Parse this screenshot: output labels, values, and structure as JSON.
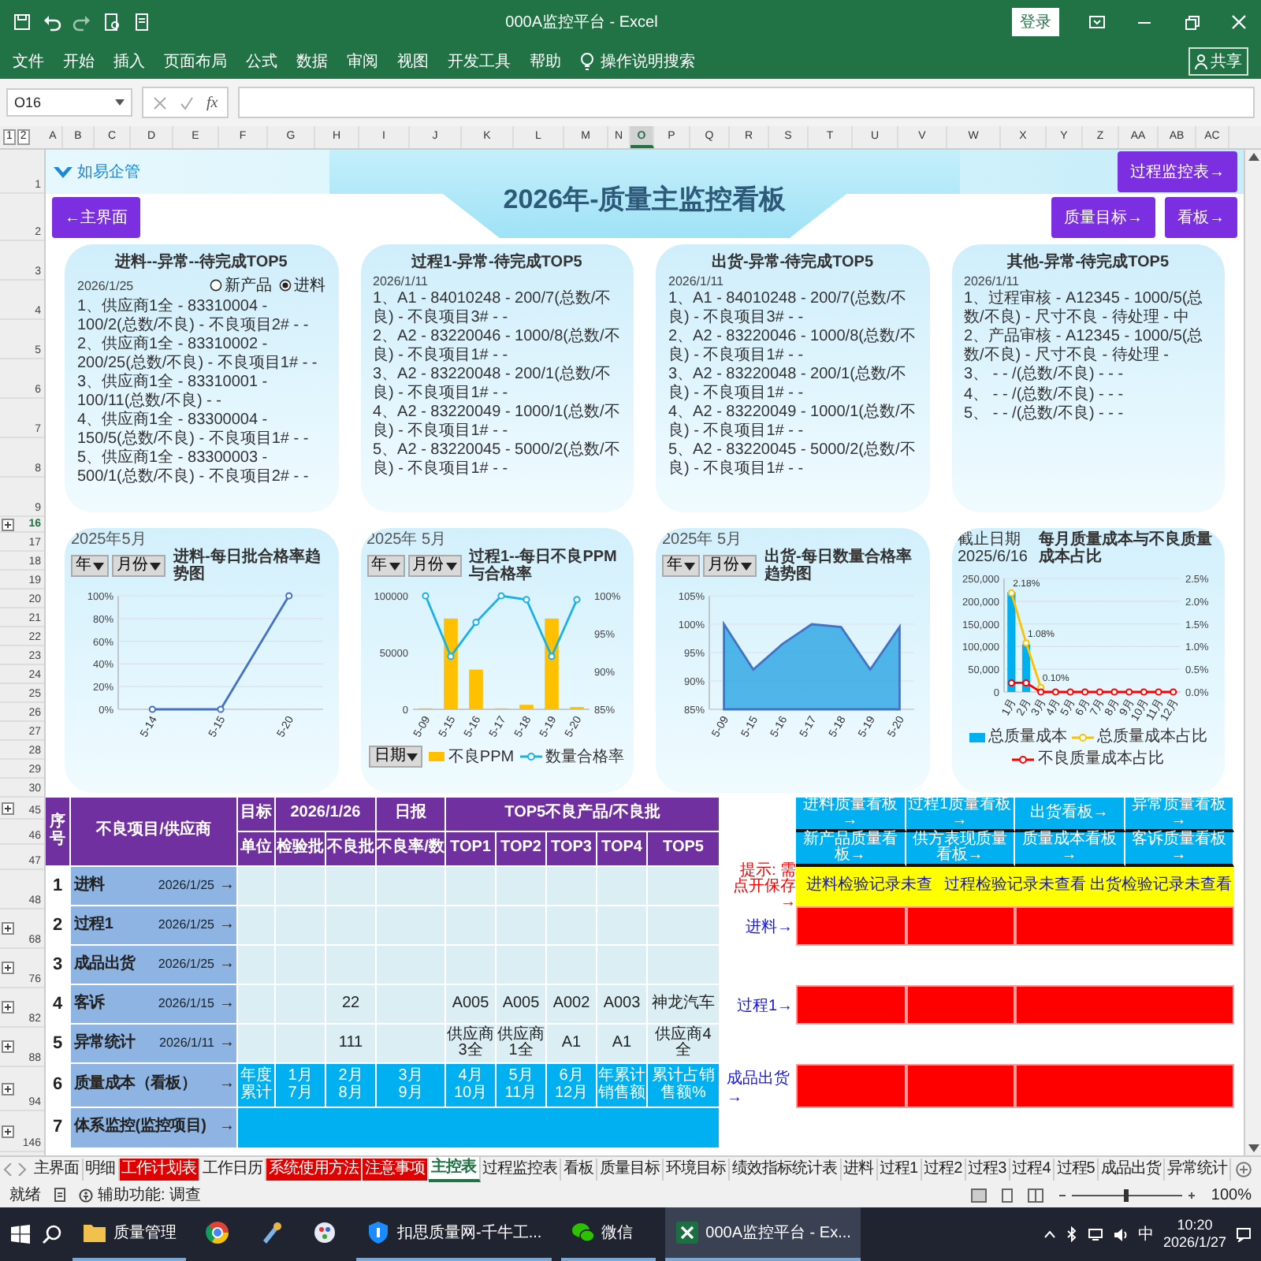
{
  "window": {
    "title": "000A监控平台 - Excel",
    "login": "登录",
    "share": "共享"
  },
  "menu": [
    "文件",
    "开始",
    "插入",
    "页面布局",
    "公式",
    "数据",
    "审阅",
    "视图",
    "开发工具",
    "帮助"
  ],
  "search_hint": "操作说明搜索",
  "formula_bar": {
    "name_box": "O16",
    "function_label": "fx"
  },
  "outline_levels": [
    "1",
    "2"
  ],
  "columns": [
    {
      "label": "A",
      "selected": false
    },
    {
      "label": "B",
      "selected": false
    },
    {
      "label": "C",
      "selected": false
    },
    {
      "label": "D",
      "selected": false
    },
    {
      "label": "E",
      "selected": false
    },
    {
      "label": "F",
      "selected": false
    },
    {
      "label": "G",
      "selected": false
    },
    {
      "label": "H",
      "selected": false
    },
    {
      "label": "I",
      "selected": false
    },
    {
      "label": "J",
      "selected": false
    },
    {
      "label": "K",
      "selected": false
    },
    {
      "label": "L",
      "selected": false
    },
    {
      "label": "M",
      "selected": false
    },
    {
      "label": "N",
      "selected": false
    },
    {
      "label": "O",
      "selected": true
    },
    {
      "label": "P",
      "selected": false
    },
    {
      "label": "Q",
      "selected": false
    },
    {
      "label": "R",
      "selected": false
    },
    {
      "label": "S",
      "selected": false
    },
    {
      "label": "T",
      "selected": false
    },
    {
      "label": "U",
      "selected": false
    },
    {
      "label": "V",
      "selected": false
    },
    {
      "label": "W",
      "selected": false
    },
    {
      "label": "X",
      "selected": false
    },
    {
      "label": "Y",
      "selected": false
    },
    {
      "label": "Z",
      "selected": false
    },
    {
      "label": "AA",
      "selected": false
    },
    {
      "label": "AB",
      "selected": false
    },
    {
      "label": "AC",
      "selected": false
    }
  ],
  "rows": [
    {
      "label": "1",
      "selected": false,
      "collapsed": false
    },
    {
      "label": "2",
      "selected": false,
      "collapsed": false
    },
    {
      "label": "3",
      "selected": false,
      "collapsed": false
    },
    {
      "label": "4",
      "selected": false,
      "collapsed": false
    },
    {
      "label": "5",
      "selected": false,
      "collapsed": false
    },
    {
      "label": "6",
      "selected": false,
      "collapsed": false
    },
    {
      "label": "7",
      "selected": false,
      "collapsed": false
    },
    {
      "label": "8",
      "selected": false,
      "collapsed": false
    },
    {
      "label": "9",
      "selected": false,
      "collapsed": false
    },
    {
      "label": "16",
      "selected": true,
      "collapsed": true
    },
    {
      "label": "17",
      "selected": false,
      "collapsed": false
    },
    {
      "label": "18",
      "selected": false,
      "collapsed": false
    },
    {
      "label": "19",
      "selected": false,
      "collapsed": false
    },
    {
      "label": "20",
      "selected": false,
      "collapsed": false
    },
    {
      "label": "21",
      "selected": false,
      "collapsed": false
    },
    {
      "label": "22",
      "selected": false,
      "collapsed": false
    },
    {
      "label": "23",
      "selected": false,
      "collapsed": false
    },
    {
      "label": "24",
      "selected": false,
      "collapsed": false
    },
    {
      "label": "25",
      "selected": false,
      "collapsed": false
    },
    {
      "label": "26",
      "selected": false,
      "collapsed": false
    },
    {
      "label": "27",
      "selected": false,
      "collapsed": false
    },
    {
      "label": "28",
      "selected": false,
      "collapsed": false
    },
    {
      "label": "29",
      "selected": false,
      "collapsed": false
    },
    {
      "label": "30",
      "selected": false,
      "collapsed": false
    },
    {
      "label": "45",
      "selected": false,
      "collapsed": true
    },
    {
      "label": "46",
      "selected": false,
      "collapsed": false
    },
    {
      "label": "47",
      "selected": false,
      "collapsed": false
    },
    {
      "label": "48",
      "selected": false,
      "collapsed": false
    },
    {
      "label": "68",
      "selected": false,
      "collapsed": true
    },
    {
      "label": "76",
      "selected": false,
      "collapsed": true
    },
    {
      "label": "82",
      "selected": false,
      "collapsed": true
    },
    {
      "label": "88",
      "selected": false,
      "collapsed": true
    },
    {
      "label": "94",
      "selected": false,
      "collapsed": true
    },
    {
      "label": "146",
      "selected": false,
      "collapsed": true
    }
  ],
  "dashboard": {
    "logo": "如易企管",
    "title": "2026年-质量主监控看板",
    "top_button": "过程监控表→",
    "left_button": "←主界面",
    "right_buttons": [
      "质量目标→",
      "看板→"
    ]
  },
  "cards": [
    {
      "title": "进料--异常--待完成TOP5",
      "date": "2026/1/25",
      "options": [
        {
          "label": "新产品",
          "selected": false
        },
        {
          "label": "进料",
          "selected": true
        }
      ],
      "items": [
        "1、供应商1全 - 83310004 - 100/2(总数/不良) - 不良项目2# - -",
        "2、供应商1全 - 83310002 - 200/25(总数/不良) - 不良项目1# - -",
        "3、供应商1全 - 83310001 - 100/11(总数/不良) - -",
        "4、供应商1全 - 83300004 - 150/5(总数/不良) - 不良项目1# - -",
        "5、供应商1全 - 83300003 - 500/1(总数/不良) - 不良项目2# - -"
      ]
    },
    {
      "title": "过程1-异常-待完成TOP5",
      "date": "2026/1/11",
      "items": [
        "1、A1 - 84010248 - 200/7(总数/不良) - 不良项目3# - -",
        "2、A2 - 83220046 - 1000/8(总数/不良) - 不良项目1# - -",
        "3、A2 - 83220048 - 200/1(总数/不良) - 不良项目1# - -",
        "4、A2 - 83220049 - 1000/1(总数/不良) - 不良项目1# - -",
        "5、A2 - 83220045 - 5000/2(总数/不良) - 不良项目1# - -"
      ]
    },
    {
      "title": "出货-异常-待完成TOP5",
      "date": "2026/1/11",
      "items": [
        "1、A1 - 84010248 - 200/7(总数/不良) - 不良项目3# - -",
        "2、A2 - 83220046 - 1000/8(总数/不良) - 不良项目1# - -",
        "3、A2 - 83220048 - 200/1(总数/不良) - 不良项目1# - -",
        "4、A2 - 83220049 - 1000/1(总数/不良) - 不良项目1# - -",
        "5、A2 - 83220045 - 5000/2(总数/不良) - 不良项目1# - -"
      ]
    },
    {
      "title": "其他-异常-待完成TOP5",
      "date": "2026/1/11",
      "items": [
        "1、过程审核 - A12345 - 1000/5(总数/不良) - 尺寸不良 - 待处理 - 中",
        "2、产品审核 - A12345 - 1000/5(总数/不良) - 尺寸不良 - 待处理 -",
        "3、 - - /(总数/不良) - - -",
        "4、 - - /(总数/不良) - - -",
        "5、 - - /(总数/不良) - - -"
      ]
    }
  ],
  "charts": [
    {
      "period": "2025年5月",
      "filters": [
        "年",
        "月份"
      ],
      "chart_data": {
        "type": "line",
        "title": "进料-每日批合格率趋势图",
        "categories": [
          "5-14",
          "5-15",
          "5-20"
        ],
        "ylim": [
          0,
          100
        ],
        "yticks": [
          {
            "value": 0,
            "label": "0%"
          },
          {
            "value": 20,
            "label": "20%"
          },
          {
            "value": 40,
            "label": "40%"
          },
          {
            "value": 60,
            "label": "60%"
          },
          {
            "value": 80,
            "label": "80%"
          },
          {
            "value": 100,
            "label": "100%"
          }
        ],
        "grid": true,
        "series": [
          {
            "color": "#4472c4",
            "marker": true,
            "values": [
              0,
              0,
              100
            ]
          }
        ]
      }
    },
    {
      "period": "2025年 5月",
      "filters": [
        "年",
        "月份"
      ],
      "bottom_filter": "日期",
      "chart_data": {
        "type": "bar",
        "title": "过程1--每日不良PPM与合格率",
        "categories": [
          "5-09",
          "5-15",
          "5-16",
          "5-17",
          "5-18",
          "5-19",
          "5-20"
        ],
        "ylim": [
          0,
          100000
        ],
        "yticks": [
          0,
          50000,
          100000
        ],
        "y2lim": [
          85,
          100
        ],
        "y2ticks": [
          {
            "value": 85,
            "label": "85%"
          },
          {
            "value": 90,
            "label": "90%"
          },
          {
            "value": 95,
            "label": "95%"
          },
          {
            "value": 100,
            "label": "100%"
          }
        ],
        "series": [
          {
            "name": "不良PPM",
            "type": "bar",
            "color": "#ffc000",
            "values": [
              0,
              80000,
              35000,
              0,
              4000,
              80000,
              2000
            ]
          },
          {
            "name": "数量合格率",
            "type": "line",
            "axis": "y2",
            "color": "#1ab0e8",
            "marker": true,
            "values": [
              100,
              92,
              96.5,
              100,
              99.5,
              92,
              99.5
            ]
          }
        ]
      }
    },
    {
      "period": "2025年 5月",
      "filters": [
        "年",
        "月份"
      ],
      "chart_data": {
        "type": "area",
        "title": "出货-每日数量合格率趋势图",
        "categories": [
          "5-09",
          "5-15",
          "5-16",
          "5-17",
          "5-18",
          "5-19",
          "5-20"
        ],
        "ylim": [
          85,
          105
        ],
        "yticks": [
          {
            "value": 85,
            "label": "85%"
          },
          {
            "value": 90,
            "label": "90%"
          },
          {
            "value": 95,
            "label": "95%"
          },
          {
            "value": 100,
            "label": "100%"
          },
          {
            "value": 105,
            "label": "105%"
          }
        ],
        "grid": true,
        "series": [
          {
            "color": "#1e9fe0",
            "values": [
              100,
              92,
              96.5,
              100,
              99.5,
              92,
              99.5
            ]
          }
        ]
      }
    },
    {
      "cutoff_label": "截止日期",
      "cutoff_date": "2025/6/16",
      "chart_data": {
        "type": "bar",
        "title": "每月质量成本与不良质量成本占比",
        "categories": [
          "1月",
          "2月",
          "3月",
          "4月",
          "5月",
          "6月",
          "7月",
          "8月",
          "9月",
          "10月",
          "11月",
          "12月"
        ],
        "ylim": [
          0,
          250000
        ],
        "yticks": [
          {
            "value": 0,
            "label": "0"
          },
          {
            "value": 50000,
            "label": "50,000"
          },
          {
            "value": 100000,
            "label": "100,000"
          },
          {
            "value": 150000,
            "label": "150,000"
          },
          {
            "value": 200000,
            "label": "200,000"
          },
          {
            "value": 250000,
            "label": "250,000"
          }
        ],
        "y2lim": [
          0,
          2.5
        ],
        "y2ticks": [
          {
            "value": 0,
            "label": "0.0%"
          },
          {
            "value": 0.5,
            "label": "0.5%"
          },
          {
            "value": 1,
            "label": "1.0%"
          },
          {
            "value": 1.5,
            "label": "1.5%"
          },
          {
            "value": 2,
            "label": "2.0%"
          },
          {
            "value": 2.5,
            "label": "2.5%"
          }
        ],
        "grid": true,
        "series": [
          {
            "name": "总质量成本",
            "type": "bar",
            "color": "#00b0f0",
            "values": [
              220000,
              105000,
              0,
              0,
              0,
              0,
              0,
              0,
              0,
              0,
              0,
              0
            ]
          },
          {
            "name": "总质量成本占比",
            "type": "line",
            "axis": "y2",
            "color": "#ffc000",
            "marker": true,
            "values": [
              2.18,
              1.08,
              0.1,
              null,
              null,
              null,
              null,
              null,
              null,
              null,
              null,
              null
            ],
            "value_labels": [
              "2.18%",
              "1.08%",
              "0.10%",
              null,
              null,
              null,
              null,
              null,
              null,
              null,
              null,
              null
            ]
          },
          {
            "name": "不良质量成本占比",
            "type": "line",
            "axis": "y2",
            "color": "#ff0000",
            "marker": true,
            "values": [
              0.2,
              0.2,
              0,
              0,
              0,
              0,
              0,
              0,
              0,
              0,
              0,
              0
            ]
          }
        ]
      }
    }
  ],
  "table": {
    "index_header": "序号",
    "item_header": "不良项目/供应商",
    "target_header": [
      "目标",
      "单位"
    ],
    "date": "2026/1/26",
    "report": "日报",
    "top_group": "TOP5不良产品/不良批",
    "columns": [
      "检验批",
      "不良批",
      "不良率/数",
      "TOP1",
      "TOP2",
      "TOP3",
      "TOP4",
      "TOP5"
    ],
    "rows": [
      {
        "index": "1",
        "name": "进料",
        "date": "2026/1/25",
        "arrow": "→",
        "kind": "data"
      },
      {
        "index": "2",
        "name": "过程1",
        "date": "2026/1/25",
        "arrow": "→",
        "kind": "data"
      },
      {
        "index": "3",
        "name": "成品出货",
        "date": "2026/1/25",
        "arrow": "→",
        "kind": "data"
      },
      {
        "index": "4",
        "name": "客诉",
        "date": "2026/1/15",
        "arrow": "→",
        "kind": "data",
        "cells": [
          null,
          null,
          "22",
          null,
          "A005",
          "A005",
          "A002",
          "A003",
          "神龙汽车"
        ]
      },
      {
        "index": "5",
        "name": "异常统计",
        "date": "2026/1/11",
        "arrow": "→",
        "kind": "data",
        "cells": [
          null,
          null,
          "111",
          null,
          "供应商3全",
          "供应商1全",
          "A1",
          "A1",
          "供应商4全"
        ]
      },
      {
        "index": "6",
        "name": "质量成本（看板）",
        "arrow": "→",
        "kind": "months",
        "cells": [
          "年度累计",
          "1月\n7月",
          "2月\n8月",
          "3月\n9月",
          "4月\n10月",
          "5月\n11月",
          "6月\n12月",
          "年累计销售额",
          "累计占销售额%"
        ]
      },
      {
        "index": "7",
        "name": "体系监控(监控项目)",
        "arrow": "→",
        "kind": "band"
      }
    ]
  },
  "side": {
    "nav_buttons": [
      "进料质量看板→",
      "过程1质量看板→",
      "出货看板→",
      "异常质量看板→",
      "新产品质量看板→",
      "供方表现质量看板→",
      "质量成本看板→",
      "客诉质量看板→"
    ],
    "hint": "提示: 需点开保存→",
    "pending": [
      "进料检验记录未查",
      "过程检验记录未查看",
      "出货检验记录未查看"
    ],
    "alerts": [
      {
        "label": "进料→",
        "flags": [
          true,
          true,
          true
        ]
      },
      {
        "label": "过程1→",
        "flags": [
          true,
          true,
          true
        ]
      },
      {
        "label": "成品出货→",
        "flags": [
          true,
          true,
          true
        ]
      }
    ]
  },
  "sheet_tabs": [
    {
      "label": "主界面",
      "selected": false
    },
    {
      "label": "明细",
      "selected": false
    },
    {
      "label": "工作计划表",
      "selected": false,
      "color": "#e00000"
    },
    {
      "label": "工作日历",
      "selected": false
    },
    {
      "label": "系统使用方法",
      "selected": false,
      "color": "#e00000"
    },
    {
      "label": "注意事项",
      "selected": false,
      "color": "#e00000"
    },
    {
      "label": "主控表",
      "selected": true
    },
    {
      "label": "过程监控表",
      "selected": false
    },
    {
      "label": "看板",
      "selected": false
    },
    {
      "label": "质量目标",
      "selected": false
    },
    {
      "label": "环境目标",
      "selected": false
    },
    {
      "label": "绩效指标统计表",
      "selected": false
    },
    {
      "label": "进料",
      "selected": false
    },
    {
      "label": "过程1",
      "selected": false
    },
    {
      "label": "过程2",
      "selected": false
    },
    {
      "label": "过程3",
      "selected": false
    },
    {
      "label": "过程4",
      "selected": false
    },
    {
      "label": "过程5",
      "selected": false
    },
    {
      "label": "成品出货",
      "selected": false
    },
    {
      "label": "异常统计",
      "selected": false
    }
  ],
  "status_bar": {
    "ready": "就绪",
    "accessibility": "辅助功能: 调查",
    "zoom": "100%"
  },
  "taskbar": {
    "apps": [
      {
        "label": "质量管理",
        "kind": "folder",
        "active": false
      },
      {
        "kind": "browser",
        "active": false
      },
      {
        "kind": "tool",
        "active": false
      },
      {
        "kind": "paint",
        "active": false
      },
      {
        "label": "扣思质量网-千牛工...",
        "kind": "shield",
        "active": false
      },
      {
        "label": "微信",
        "kind": "chat",
        "active": false
      },
      {
        "label": "000A监控平台 - Ex...",
        "kind": "sheet",
        "active": true
      }
    ],
    "ime": "中",
    "time": "10:20",
    "date": "2026/1/27"
  }
}
